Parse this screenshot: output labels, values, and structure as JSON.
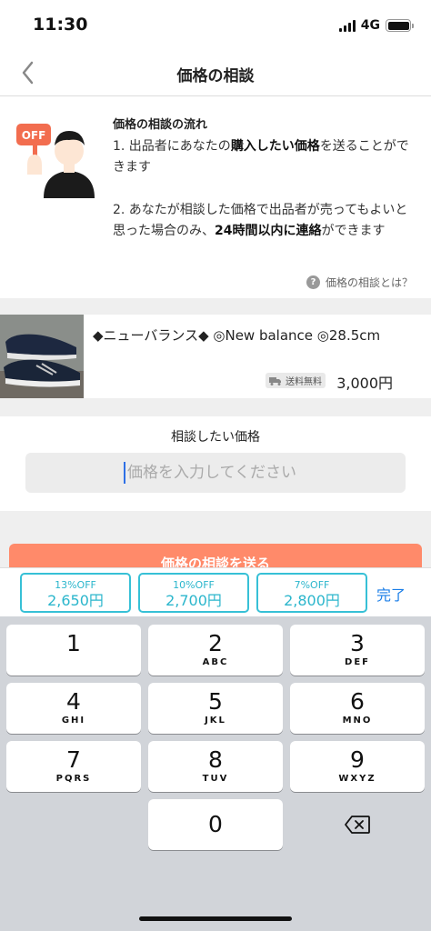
{
  "status_bar": {
    "time": "11:30",
    "network": "4G"
  },
  "nav": {
    "title": "価格の相談"
  },
  "flow": {
    "title": "価格の相談の流れ",
    "step1_pre": "1. 出品者にあなたの",
    "step1_bold": "購入したい価格",
    "step1_post": "を送ることができます",
    "step2_pre": "2. あなたが相談した価格で出品者が売ってもよいと思った場合のみ、",
    "step2_bold": "24時間以内に連絡",
    "step2_post": "ができます",
    "help_link": "価格の相談とは？",
    "badge_text": "OFF"
  },
  "product": {
    "name": "◆ニューバランス◆ ◎New balance ◎28.5cm",
    "shipping_label": "送料無料",
    "price": "3,000円"
  },
  "price_input": {
    "label": "相談したい価格",
    "placeholder": "価格を入力してください"
  },
  "submit": {
    "label": "価格の相談を送る"
  },
  "suggestions": [
    {
      "percent": "13%OFF",
      "price": "2,650円"
    },
    {
      "percent": "10%OFF",
      "price": "2,700円"
    },
    {
      "percent": "7%OFF",
      "price": "2,800円"
    }
  ],
  "done_label": "完了",
  "keypad": [
    {
      "num": "1",
      "letters": ""
    },
    {
      "num": "2",
      "letters": "ABC"
    },
    {
      "num": "3",
      "letters": "DEF"
    },
    {
      "num": "4",
      "letters": "GHI"
    },
    {
      "num": "5",
      "letters": "JKL"
    },
    {
      "num": "6",
      "letters": "MNO"
    },
    {
      "num": "7",
      "letters": "PQRS"
    },
    {
      "num": "8",
      "letters": "TUV"
    },
    {
      "num": "9",
      "letters": "WXYZ"
    },
    {
      "num": "0",
      "letters": ""
    }
  ],
  "colors": {
    "accent_cyan": "#37c0d6",
    "submit_orange": "#ff8a6a",
    "badge_orange": "#f26d4f",
    "done_blue": "#1a7ee8",
    "cursor_blue": "#2d6fe6"
  }
}
